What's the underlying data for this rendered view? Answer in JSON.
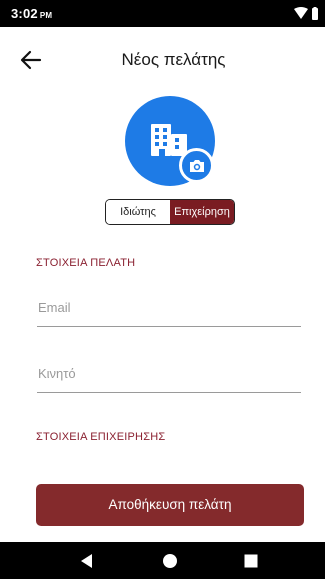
{
  "status_bar": {
    "time": "3:02",
    "ampm": "PM",
    "icons": [
      "wifi-icon",
      "battery-icon"
    ]
  },
  "app_bar": {
    "title": "Νέος πελάτης",
    "back_icon": "arrow-left-icon"
  },
  "avatar": {
    "icon": "building-icon",
    "action_icon": "camera-icon",
    "color": "#1e7be6"
  },
  "customer_type": {
    "options": [
      "Ιδιώτης",
      "Επιχείρηση"
    ],
    "selected": "Επιχείρηση"
  },
  "sections": {
    "customer_details": "ΣΤΟΙΧΕΙΑ ΠΕΛΑΤΗ",
    "business_details": "ΣΤΟΙΧΕΙΑ ΕΠΙΧΕΙΡΗΣΗΣ"
  },
  "form": {
    "email": {
      "placeholder": "Email",
      "value": ""
    },
    "mobile": {
      "placeholder": "Κινητό",
      "value": ""
    }
  },
  "actions": {
    "save_label": "Αποθήκευση πελάτη"
  },
  "navigation_bar": {
    "icons": [
      "nav-back-icon",
      "nav-home-icon",
      "nav-recents-icon"
    ]
  },
  "colors": {
    "accent": "#7a1c22",
    "button": "#842a2c",
    "avatar": "#1e7be6",
    "section_label": "#8a2030"
  }
}
